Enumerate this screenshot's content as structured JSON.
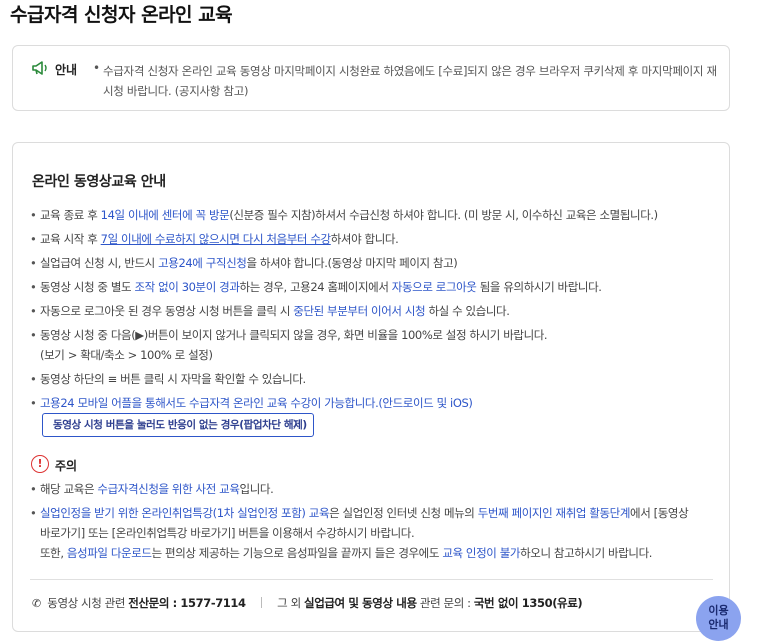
{
  "page": {
    "title": "수급자격 신청자 온라인 교육"
  },
  "notice": {
    "label": "안내",
    "bullet": "•",
    "text": "수급자격 신청자 온라인 교육 동영상 마지막페이지 시청완료 하였음에도 [수료]되지 않은 경우 브라우저 쿠키삭제 후 마지막페이지 재시청 바랍니다. (공지사항 참고)"
  },
  "guide": {
    "title": "온라인 동영상교육 안내",
    "items": [
      {
        "a": "교육 종료 후 ",
        "b": "14일 이내에 센터에 꼭 방문",
        "c": "(신분증 필수 지참)하셔서 수급신청 하셔야 합니다. (미 방문 시, 이수하신 교육은 소멸됩니다.)"
      },
      {
        "a": "교육 시작 후 ",
        "b": "7일 이내에 수료하지 않으시면 다시 처음부터 수강",
        "c": "하셔야 합니다."
      },
      {
        "a": "실업급여 신청 시, 반드시 ",
        "b": "고용24에 구직신청",
        "c": "을 하셔야 합니다.(동영상 마지막 페이지 참고)"
      },
      {
        "a": "동영상 시청 중 별도 ",
        "b": "조작 없이 30분이 경과",
        "c": "하는 경우, 고용24 홈페이지에서 ",
        "d": "자동으로 로그아웃",
        "e": " 됨을 유의하시기 바랍니다."
      },
      {
        "a": "자동으로 로그아웃 된 경우 동영상 시청 버튼을 클릭 시 ",
        "b": "중단된 부분부터 이어서 시청",
        "c": " 하실 수 있습니다."
      },
      {
        "a": "동영상 시청 중 다음(▶)버튼이 보이지 않거나 클릭되지 않을 경우, 화면 비율을 100%로 설정 하시기 바랍니다.",
        "b": "(보기 > 확대/축소 > 100% 로 설정)"
      },
      {
        "a": "동영상 하단의 ≡ 버튼 클릭 시 자막을 확인할 수 있습니다."
      },
      {
        "a": "고용24 모바일 어플을 통해서도 수급자격 온라인 교육 수강이 가능합니다.(안드로이드 및 iOS)"
      }
    ],
    "popup_button": "동영상 시청 버튼을 눌러도 반응이 없는 경우(팝업차단 해제)",
    "popup_chevron": "〉"
  },
  "caution": {
    "icon": "!",
    "label": "주의",
    "item1_a": "해당 교육은 ",
    "item1_b": "수급자격신청을 위한 사전 교육",
    "item1_c": "입니다.",
    "item2_a": "실업인정을 받기 위한 온라인취업특강(1차 실업인정 포함) 교육",
    "item2_b": "은 실업인정 인터넷 신청 메뉴의 ",
    "item2_c": "두번째 페이지인 재취업 활동단계",
    "item2_d": "에서 [동영상",
    "item2_line2": "바로가기] 또는 [온라인취업특강 바로가기] 버튼을 이용해서 수강하시기 바랍니다.",
    "item2_line3_a": "또한, ",
    "item2_line3_b": "음성파일 다운로드",
    "item2_line3_c": "는 편의상 제공하는 기능으로 음성파일을 끝까지 들은 경우에도 ",
    "item2_line3_d": "교육 인정이 불가",
    "item2_line3_e": "하오니 참고하시기 바랍니다."
  },
  "footer": {
    "left_label": "동영상 시청 관련 ",
    "left_bold": "전산문의 : 1577-7114",
    "right_label": "그 외 ",
    "right_bold1": "실업급여 및 동영상 내용",
    "right_mid": " 관련 문의 : ",
    "right_bold2": "국번 없이 1350(유료)"
  },
  "help_fab": {
    "line1": "이용",
    "line2": "안내"
  },
  "colors": {
    "link_blue": "#2e56c9",
    "fab": "#8ba3ef",
    "warn_red": "#dd3333"
  }
}
